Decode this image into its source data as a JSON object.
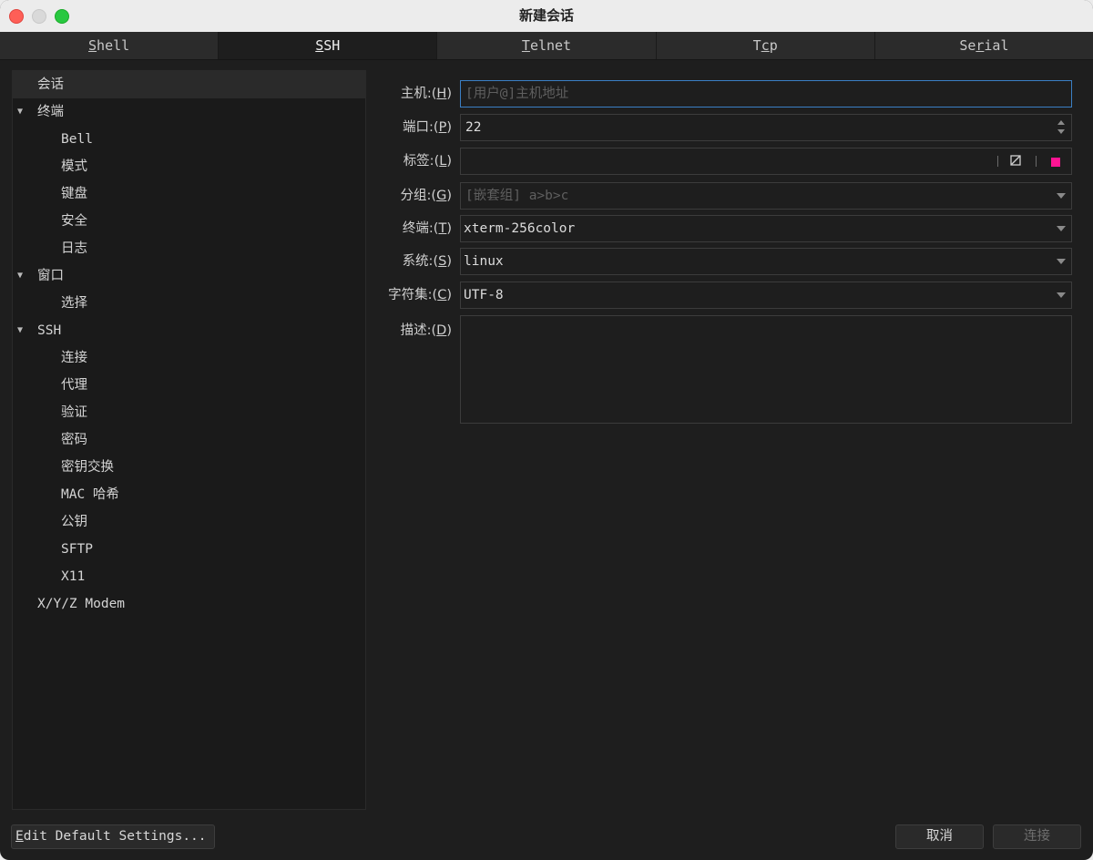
{
  "window": {
    "title": "新建会话"
  },
  "tabs": [
    {
      "pre": "",
      "mn": "S",
      "post": "hell",
      "active": false
    },
    {
      "pre": "",
      "mn": "S",
      "post": "SH",
      "active": true
    },
    {
      "pre": "",
      "mn": "T",
      "post": "elnet",
      "active": false
    },
    {
      "pre": "T",
      "mn": "c",
      "post": "p",
      "active": false
    },
    {
      "pre": "Se",
      "mn": "r",
      "post": "ial",
      "active": false
    }
  ],
  "tree": {
    "items": [
      {
        "label": "会话",
        "level": 0,
        "expanded": null,
        "selected": true
      },
      {
        "label": "终端",
        "level": 0,
        "expanded": true,
        "selected": false
      },
      {
        "label": "Bell",
        "level": 1,
        "expanded": null,
        "selected": false
      },
      {
        "label": "模式",
        "level": 1,
        "expanded": null,
        "selected": false
      },
      {
        "label": "键盘",
        "level": 1,
        "expanded": null,
        "selected": false
      },
      {
        "label": "安全",
        "level": 1,
        "expanded": null,
        "selected": false
      },
      {
        "label": "日志",
        "level": 1,
        "expanded": null,
        "selected": false
      },
      {
        "label": "窗口",
        "level": 0,
        "expanded": true,
        "selected": false
      },
      {
        "label": "选择",
        "level": 1,
        "expanded": null,
        "selected": false
      },
      {
        "label": "SSH",
        "level": 0,
        "expanded": true,
        "selected": false
      },
      {
        "label": "连接",
        "level": 1,
        "expanded": null,
        "selected": false
      },
      {
        "label": "代理",
        "level": 1,
        "expanded": null,
        "selected": false
      },
      {
        "label": "验证",
        "level": 1,
        "expanded": null,
        "selected": false
      },
      {
        "label": "密码",
        "level": 1,
        "expanded": null,
        "selected": false
      },
      {
        "label": "密钥交换",
        "level": 1,
        "expanded": null,
        "selected": false
      },
      {
        "label": "MAC 哈希",
        "level": 1,
        "expanded": null,
        "selected": false
      },
      {
        "label": "公钥",
        "level": 1,
        "expanded": null,
        "selected": false
      },
      {
        "label": "SFTP",
        "level": 1,
        "expanded": null,
        "selected": false
      },
      {
        "label": "X11",
        "level": 1,
        "expanded": null,
        "selected": false
      },
      {
        "label": "X/Y/Z Modem",
        "level": 0,
        "expanded": null,
        "selected": false
      }
    ]
  },
  "form": {
    "host": {
      "label_pre": "主机:(",
      "label_mn": "H",
      "label_post": ")",
      "value": "",
      "placeholder": "[用户@]主机地址"
    },
    "port": {
      "label_pre": "端口:(",
      "label_mn": "P",
      "label_post": ")",
      "value": "22"
    },
    "tag": {
      "label_pre": "标签:(",
      "label_mn": "L",
      "label_post": ")",
      "value": "",
      "color": "#ff1493"
    },
    "group": {
      "label_pre": "分组:(",
      "label_mn": "G",
      "label_post": ")",
      "value": "",
      "placeholder": "[嵌套组] a>b>c"
    },
    "terminal": {
      "label_pre": "终端:(",
      "label_mn": "T",
      "label_post": ")",
      "value": "xterm-256color"
    },
    "system": {
      "label_pre": "系统:(",
      "label_mn": "S",
      "label_post": ")",
      "value": "linux"
    },
    "charset": {
      "label_pre": "字符集:(",
      "label_mn": "C",
      "label_post": ")",
      "value": "UTF-8"
    },
    "description": {
      "label_pre": "描述:(",
      "label_mn": "D",
      "label_post": ")",
      "value": ""
    }
  },
  "buttons": {
    "edit_defaults_mn": "E",
    "edit_defaults_rest": "dit Default Settings...",
    "cancel": "取消",
    "connect": "连接"
  },
  "colors": {
    "accent_focus": "#3b7fc4",
    "background": "#1e1e1e",
    "tag_color": "#ff1493"
  },
  "icons": {
    "close": "close-icon",
    "edit": "edit-icon",
    "dropdown": "chevron-down-icon",
    "expand": "triangle-down-icon"
  }
}
